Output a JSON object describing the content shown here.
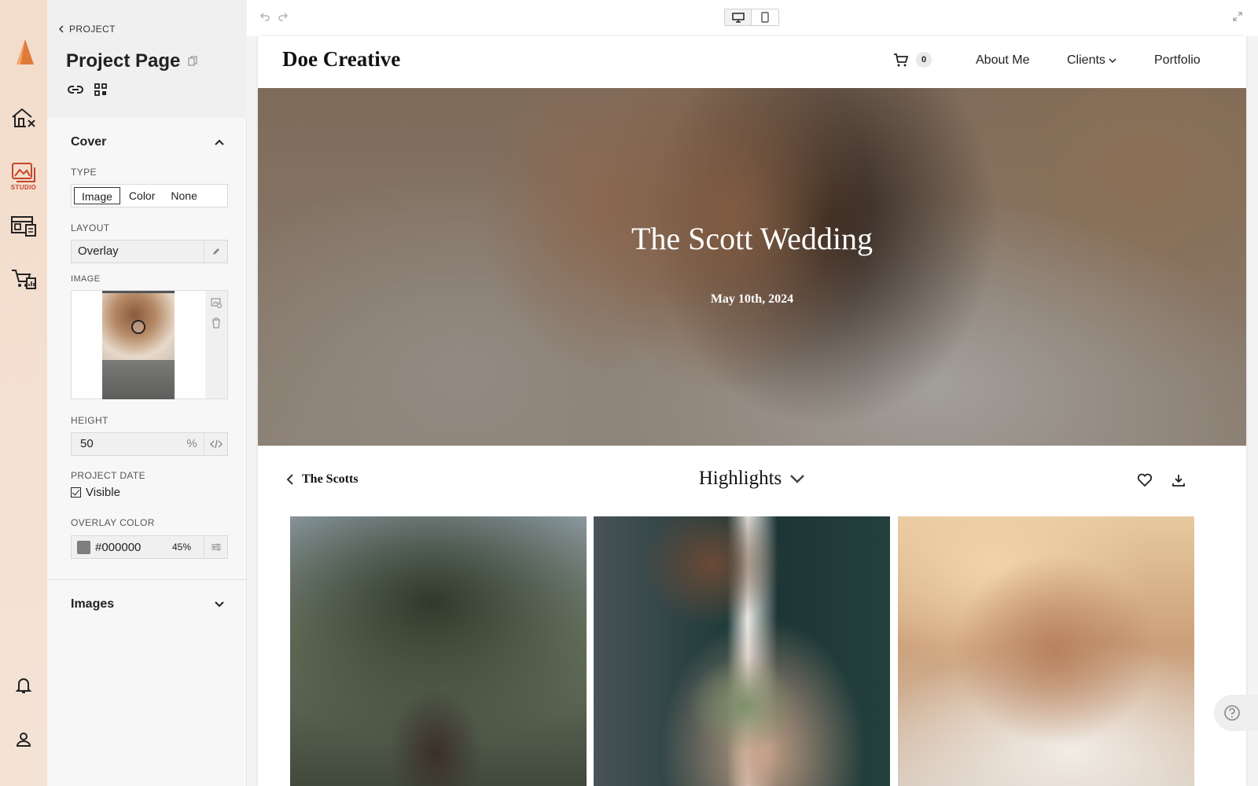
{
  "rail": {
    "studio_caption": "STUDIO"
  },
  "panel": {
    "breadcrumb": "PROJECT",
    "page_title": "Project Page",
    "cover": {
      "title": "Cover",
      "type_label": "TYPE",
      "type_options": [
        "Image",
        "Color",
        "None"
      ],
      "type_selected": "Image",
      "layout_label": "LAYOUT",
      "layout_value": "Overlay",
      "image_label": "IMAGE",
      "height_label": "HEIGHT",
      "height_value": "50",
      "height_unit": "%",
      "project_date_label": "PROJECT DATE",
      "project_date_visible_label": "Visible",
      "project_date_visible": true,
      "overlay_color_label": "OVERLAY COLOR",
      "overlay_color_hex": "#000000",
      "overlay_color_opacity": "45%",
      "overlay_swatch": "#7f7f7f"
    },
    "images_section_title": "Images"
  },
  "site": {
    "brand": "Doe Creative",
    "cart_count": "0",
    "nav": [
      "About Me",
      "Clients",
      "Portfolio"
    ],
    "hero_title": "The Scott Wedding",
    "hero_date": "May 10th, 2024",
    "back_label": "The Scotts",
    "collection_title": "Highlights"
  },
  "colors": {
    "accent": "#c8452b",
    "rail_bg": "#f3dccb"
  }
}
